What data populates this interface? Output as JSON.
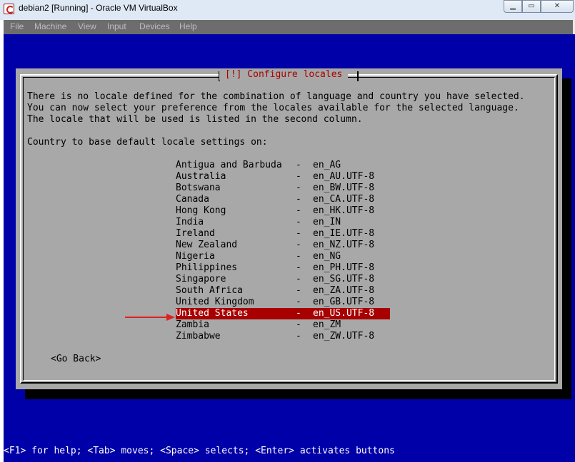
{
  "window": {
    "title": "debian2 [Running] - Oracle VM VirtualBox",
    "buttons": {
      "minimize": "▁",
      "maximize": "▭",
      "close": "✕"
    }
  },
  "menu": [
    "File",
    "Machine",
    "View",
    "Input",
    "Devices",
    "Help"
  ],
  "dialog": {
    "title": "[!] Configure locales",
    "intro": [
      "There is no locale defined for the combination of language and country you have selected.",
      "You can now select your preference from the locales available for the selected language.",
      "The locale that will be used is listed in the second column."
    ],
    "prompt": "Country to base default locale settings on:",
    "separator": "-",
    "options": [
      {
        "country": "Antigua and Barbuda",
        "locale": "en_AG"
      },
      {
        "country": "Australia",
        "locale": "en_AU.UTF-8"
      },
      {
        "country": "Botswana",
        "locale": "en_BW.UTF-8"
      },
      {
        "country": "Canada",
        "locale": "en_CA.UTF-8"
      },
      {
        "country": "Hong Kong",
        "locale": "en_HK.UTF-8"
      },
      {
        "country": "India",
        "locale": "en_IN"
      },
      {
        "country": "Ireland",
        "locale": "en_IE.UTF-8"
      },
      {
        "country": "New Zealand",
        "locale": "en_NZ.UTF-8"
      },
      {
        "country": "Nigeria",
        "locale": "en_NG"
      },
      {
        "country": "Philippines",
        "locale": "en_PH.UTF-8"
      },
      {
        "country": "Singapore",
        "locale": "en_SG.UTF-8"
      },
      {
        "country": "South Africa",
        "locale": "en_ZA.UTF-8"
      },
      {
        "country": "United Kingdom",
        "locale": "en_GB.UTF-8"
      },
      {
        "country": "United States",
        "locale": "en_US.UTF-8"
      },
      {
        "country": "Zambia",
        "locale": "en_ZM"
      },
      {
        "country": "Zimbabwe",
        "locale": "en_ZW.UTF-8"
      }
    ],
    "selected_index": 13,
    "go_back": "<Go Back>"
  },
  "help_line": "<F1> for help; <Tab> moves; <Space> selects; <Enter> activates buttons",
  "colors": {
    "screen_bg": "#0000a8",
    "dialog_bg": "#a8a8a8",
    "title_color": "#a80000",
    "selection_bg": "#a80000",
    "arrow_color": "#e02020"
  }
}
